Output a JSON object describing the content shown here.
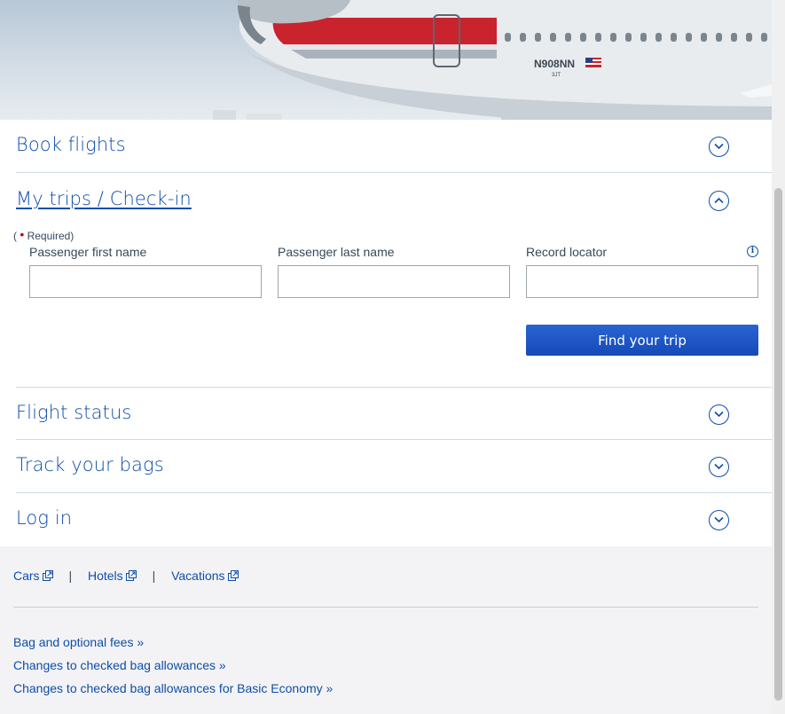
{
  "hero": {
    "tail_number": "N908NN",
    "sub_code": "3JT"
  },
  "accordion": {
    "book_flights": "Book flights",
    "my_trips": "My trips / Check-in",
    "flight_status": "Flight status",
    "track_bags": "Track your bags",
    "log_in": "Log in"
  },
  "form": {
    "required_open": "(",
    "required_label": "Required)",
    "first_name_label": "Passenger first name",
    "last_name_label": "Passenger last name",
    "record_locator_label": "Record locator",
    "first_name_value": "",
    "last_name_value": "",
    "record_locator_value": "",
    "submit_label": "Find your trip"
  },
  "footer": {
    "cars": "Cars",
    "hotels": "Hotels",
    "vacations": "Vacations",
    "separator": "|",
    "bag_fees": "Bag and optional fees »",
    "checked_bag_changes": "Changes to checked bag allowances »",
    "checked_bag_basic": "Changes to checked bag allowances for Basic Economy »"
  },
  "colors": {
    "link_blue": "#0e4ea8",
    "button_blue": "#1d56c4",
    "required_red": "#c30019",
    "text_gray": "#36495a"
  },
  "icons": {
    "chevron_down": "chevron-down-circle-icon",
    "chevron_up": "chevron-up-circle-icon",
    "info": "info-icon",
    "external": "external-link-icon"
  }
}
